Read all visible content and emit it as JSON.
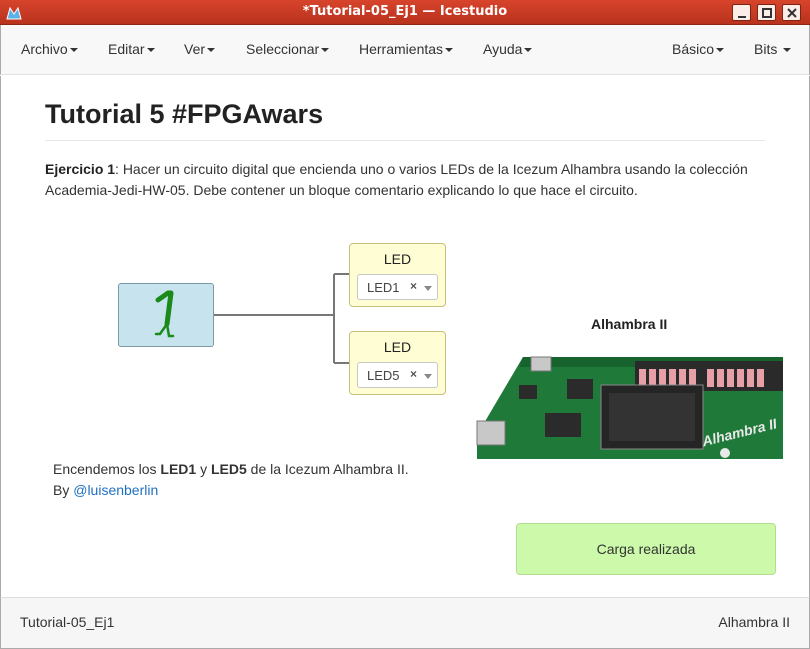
{
  "window": {
    "title": "*Tutorial-05_Ej1 — Icestudio",
    "controls": [
      "minimize-icon",
      "maximize-icon",
      "close-icon"
    ]
  },
  "menu": {
    "left": [
      "Archivo",
      "Editar",
      "Ver",
      "Seleccionar",
      "Herramientas",
      "Ayuda"
    ],
    "right": [
      "Básico",
      "Bits"
    ]
  },
  "page": {
    "title": "Tutorial 5 #FPGAwars",
    "description": {
      "bold": "Ejercicio 1",
      "text": ": Hacer un circuito digital que encienda uno o varios LEDs de la Icezum Alhambra usando la colección Academia-Jedi-HW-05. Debe contener un bloque comentario explicando lo que hace el circuito."
    }
  },
  "circuit": {
    "constant_icon": "bit-one-icon",
    "constant_color": "#c7e3ee",
    "led_color": "#fefdd4",
    "led_blocks": [
      {
        "title": "LED",
        "value": "LED1",
        "clear": "×"
      },
      {
        "title": "LED",
        "value": "LED5",
        "clear": "×"
      }
    ]
  },
  "board": {
    "title": "Alhambra II",
    "image_icon": "alhambra-board-image",
    "silkscreen": "Alhambra II"
  },
  "comment": {
    "p1": "Encendemos los ",
    "led_a": "LED1",
    "p2": " y ",
    "led_b": "LED5",
    "p3": " de la Icezum Alhambra II.",
    "by": "By ",
    "author": "@luisenberlin"
  },
  "notification": {
    "text": "Carga realizada",
    "color": "#cdfaaa"
  },
  "footer": {
    "left": "Tutorial-05_Ej1",
    "right": "Alhambra II"
  },
  "colors": {
    "titlebar": "#c63b24",
    "link": "#1f6fc1"
  }
}
